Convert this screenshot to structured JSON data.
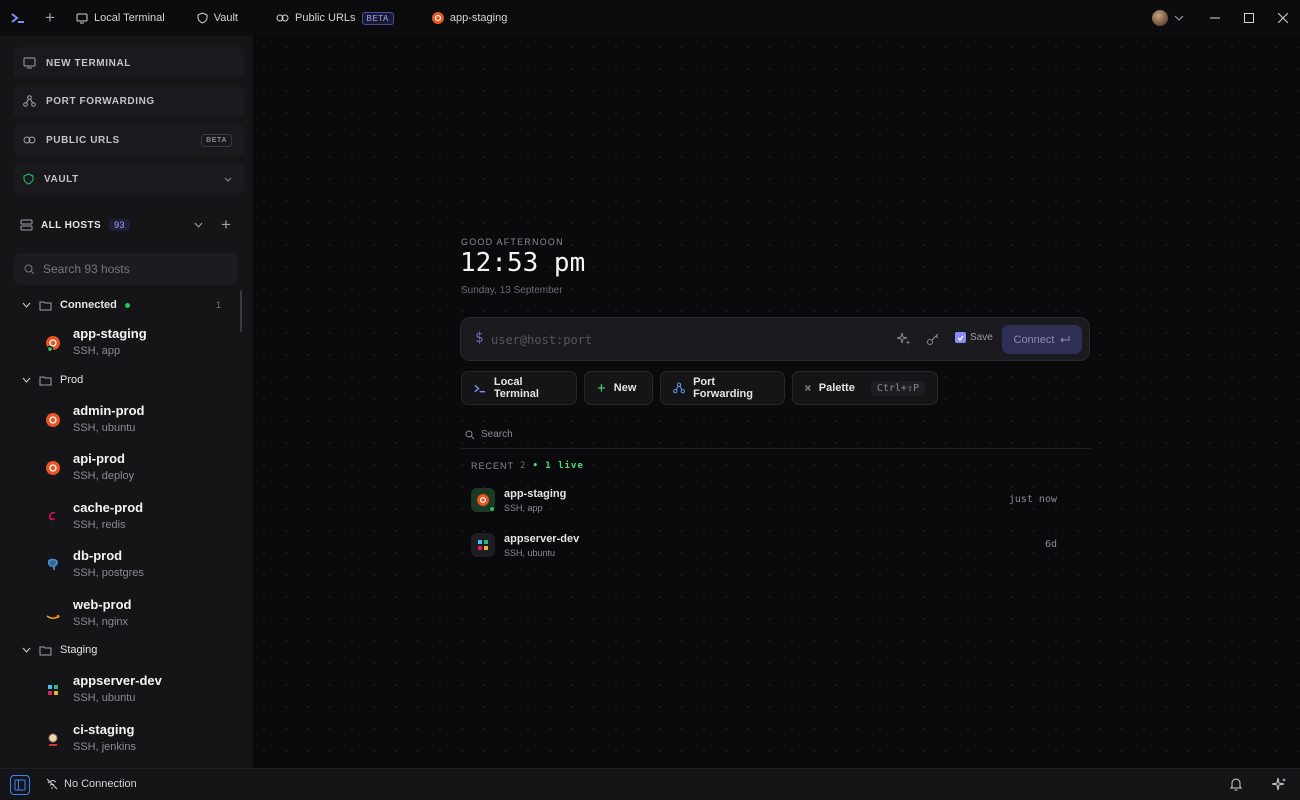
{
  "titlebar": {
    "tabs": [
      {
        "label": "Local Terminal",
        "icon": "monitor-icon"
      },
      {
        "label": "Vault",
        "icon": "shield-icon"
      },
      {
        "label": "Public URLs",
        "icon": "link-icon",
        "badge": "BETA"
      },
      {
        "label": "app-staging",
        "icon": "ubuntu-icon"
      }
    ]
  },
  "sidebar": {
    "nav": [
      {
        "label": "NEW TERMINAL",
        "icon": "monitor-icon"
      },
      {
        "label": "PORT FORWARDING",
        "icon": "network-icon"
      },
      {
        "label": "PUBLIC URLS",
        "icon": "link-icon",
        "badge": "BETA"
      },
      {
        "label": "VAULT",
        "icon": "shield-icon"
      }
    ],
    "all_hosts_label": "ALL HOSTS",
    "all_hosts_count": "93",
    "search_placeholder": "Search 93 hosts",
    "groups": [
      {
        "name": "Connected",
        "count": "1",
        "hosts": [
          {
            "name": "app-staging",
            "sub": "SSH, app",
            "icon": "ubuntu-icon"
          }
        ]
      },
      {
        "name": "Prod",
        "hosts": [
          {
            "name": "admin-prod",
            "sub": "SSH, ubuntu",
            "icon": "ubuntu-icon"
          },
          {
            "name": "api-prod",
            "sub": "SSH, deploy",
            "icon": "ubuntu-icon"
          },
          {
            "name": "cache-prod",
            "sub": "SSH, redis",
            "icon": "debian-icon"
          },
          {
            "name": "db-prod",
            "sub": "SSH, postgres",
            "icon": "postgres-icon"
          },
          {
            "name": "web-prod",
            "sub": "SSH, nginx",
            "icon": "amazon-icon"
          }
        ]
      },
      {
        "name": "Staging",
        "hosts": [
          {
            "name": "appserver-dev",
            "sub": "SSH, ubuntu",
            "icon": "slack-icon"
          },
          {
            "name": "ci-staging",
            "sub": "SSH, jenkins",
            "icon": "jenkins-icon"
          }
        ]
      }
    ]
  },
  "main": {
    "greeting": "GOOD AFTERNOON",
    "time": "12:53 pm",
    "date": "Sunday, 13 September",
    "connect": {
      "prompt": "$",
      "placeholder": "user@host:port",
      "save_label": "Save",
      "button_label": "Connect"
    },
    "quick_actions": [
      {
        "label": "Local Terminal",
        "icon": "terminal-icon"
      },
      {
        "label": "New",
        "icon": "plus-icon"
      },
      {
        "label": "Port Forwarding",
        "icon": "network-icon"
      },
      {
        "label": "Palette",
        "icon": "command-icon",
        "shortcut": "Ctrl+⇧P"
      }
    ],
    "search_label": "Search",
    "recent": {
      "label": "RECENT",
      "count": "2",
      "live": "• 1 live",
      "items": [
        {
          "name": "app-staging",
          "sub": "SSH, app",
          "time": "just now",
          "live": true
        },
        {
          "name": "appserver-dev",
          "sub": "SSH, ubuntu",
          "time": "6d",
          "live": false
        }
      ]
    }
  },
  "statusbar": {
    "connection": "No Connection"
  },
  "colors": {
    "accent": "#8b8bf5",
    "live": "#22c55e",
    "ubuntu": "#e95420"
  }
}
